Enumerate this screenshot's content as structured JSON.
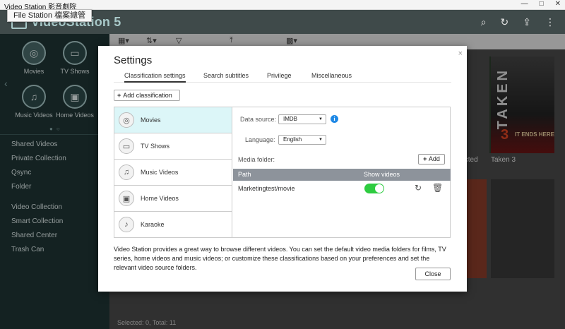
{
  "window": {
    "title": "Video Station 影音劇院",
    "tooltip": "File Station 檔案總管"
  },
  "header": {
    "app_name": "VideoStation 5"
  },
  "sidebar": {
    "categories": [
      {
        "label": "Movies",
        "icon": "film-reel-icon"
      },
      {
        "label": "TV Shows",
        "icon": "tv-icon"
      },
      {
        "label": "Music Videos",
        "icon": "music-note-icon"
      },
      {
        "label": "Home Videos",
        "icon": "camcorder-icon"
      }
    ],
    "group1": [
      "Shared Videos",
      "Private Collection",
      "Qsync",
      "Folder"
    ],
    "group2": [
      "Video Collection",
      "Smart Collection",
      "Shared Center",
      "Trash Can"
    ]
  },
  "background": {
    "poster_caption_partial": "lected",
    "poster_caption": "Taken 3",
    "poster_title": "TAKEN",
    "poster_number": "3",
    "poster_tagline": "IT ENDS HERE",
    "status": "Selected: 0, Total: 11"
  },
  "dialog": {
    "title": "Settings",
    "close_glyph": "×",
    "tabs": [
      "Classification settings",
      "Search subtitles",
      "Privilege",
      "Miscellaneous"
    ],
    "add_classification_label": "Add classification",
    "classifications": [
      {
        "label": "Movies",
        "icon": "film-reel-icon"
      },
      {
        "label": "TV Shows",
        "icon": "tv-icon"
      },
      {
        "label": "Music Videos",
        "icon": "music-note-icon"
      },
      {
        "label": "Home Videos",
        "icon": "camcorder-icon"
      },
      {
        "label": "Karaoke",
        "icon": "microphone-icon"
      }
    ],
    "data_source_label": "Data source:",
    "data_source_value": "IMDB",
    "language_label": "Language:",
    "language_value": "English",
    "media_folder_label": "Media folder:",
    "add_label": "Add",
    "table": {
      "col_path": "Path",
      "col_show": "Show videos",
      "rows": [
        {
          "path": "Marketingtest/movie",
          "show": true
        }
      ]
    },
    "description": "Video Station provides a great way to browse different videos. You can set the default video media folders for films, TV series, home videos and music videos; or customize these classifications based on your preferences and set the relevant video source folders.",
    "close_label": "Close"
  }
}
